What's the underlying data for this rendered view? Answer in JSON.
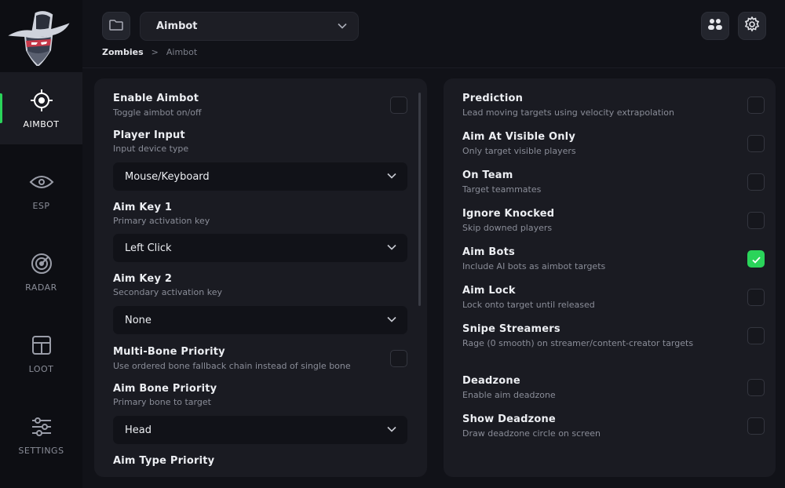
{
  "colors": {
    "accent": "#2ad45a",
    "panel": "#1a1b22",
    "background": "#111218",
    "sidebar": "#0d0e13"
  },
  "sidebar": {
    "items": [
      {
        "label": "AIMBOT",
        "icon": "crosshair-icon",
        "active": true
      },
      {
        "label": "ESP",
        "icon": "eye-icon",
        "active": false
      },
      {
        "label": "RADAR",
        "icon": "radar-icon",
        "active": false
      },
      {
        "label": "LOOT",
        "icon": "box-icon",
        "active": false
      },
      {
        "label": "SETTINGS",
        "icon": "sliders-icon",
        "active": false
      }
    ]
  },
  "header": {
    "selected": "Aimbot",
    "breadcrumb": {
      "first": "Zombies",
      "separator": ">",
      "second": "Aimbot"
    }
  },
  "left": {
    "enable_aimbot": {
      "title": "Enable Aimbot",
      "desc": "Toggle aimbot on/off",
      "checked": false
    },
    "player_input": {
      "title": "Player Input",
      "desc": "Input device type",
      "value": "Mouse/Keyboard"
    },
    "aim_key_1": {
      "title": "Aim Key 1",
      "desc": "Primary activation key",
      "value": "Left Click"
    },
    "aim_key_2": {
      "title": "Aim Key 2",
      "desc": "Secondary activation key",
      "value": "None"
    },
    "multi_bone": {
      "title": "Multi-Bone Priority",
      "desc": "Use ordered bone fallback chain instead of single bone",
      "checked": false
    },
    "aim_bone": {
      "title": "Aim Bone Priority",
      "desc": "Primary bone to target",
      "value": "Head"
    },
    "aim_type": {
      "title": "Aim Type Priority"
    }
  },
  "right": {
    "options": [
      {
        "title": "Prediction",
        "desc": "Lead moving targets using velocity extrapolation",
        "checked": false
      },
      {
        "title": "Aim At Visible Only",
        "desc": "Only target visible players",
        "checked": false
      },
      {
        "title": "On Team",
        "desc": "Target teammates",
        "checked": false
      },
      {
        "title": "Ignore Knocked",
        "desc": "Skip downed players",
        "checked": false
      },
      {
        "title": "Aim Bots",
        "desc": "Include AI bots as aimbot targets",
        "checked": true
      },
      {
        "title": "Aim Lock",
        "desc": "Lock onto target until released",
        "checked": false
      },
      {
        "title": "Snipe Streamers",
        "desc": "Rage (0 smooth) on streamer/content-creator targets",
        "checked": false
      },
      {
        "title": "Deadzone",
        "desc": "Enable aim deadzone",
        "checked": false
      },
      {
        "title": "Show Deadzone",
        "desc": "Draw deadzone circle on screen",
        "checked": false
      }
    ]
  }
}
